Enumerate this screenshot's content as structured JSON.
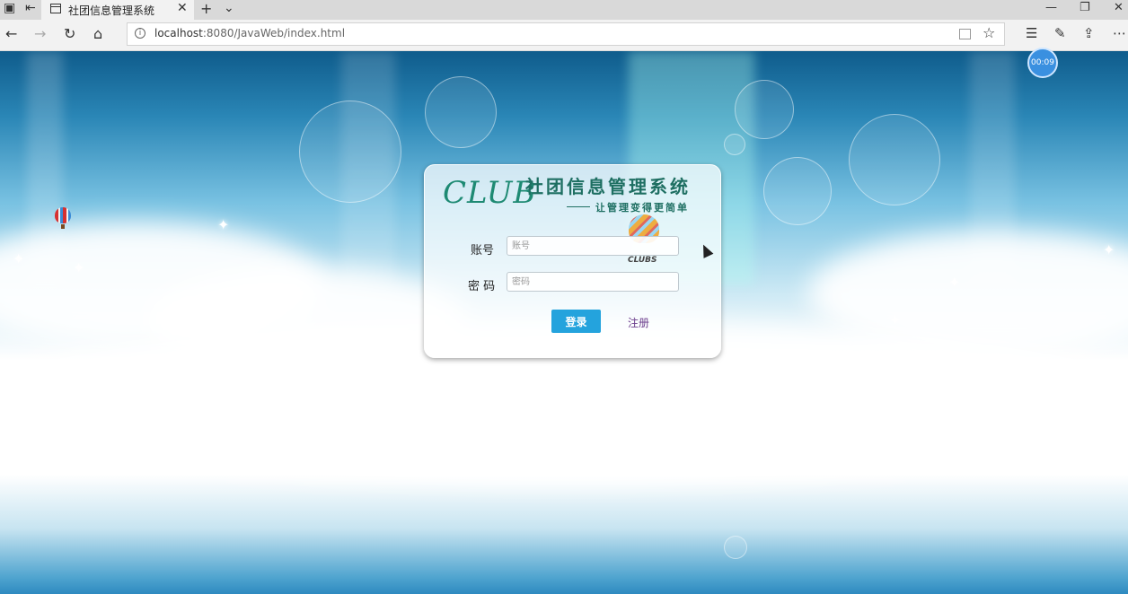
{
  "browser": {
    "tab_title": "社团信息管理系统",
    "tab_close_glyph": "✕",
    "new_tab_glyph": "+",
    "tab_list_glyph": "⌄",
    "url_host": "localhost",
    "url_rest": ":8080/JavaWeb/index.html",
    "window_controls": [
      "—",
      "❐",
      "✕"
    ],
    "nav_icons": [
      "back-icon",
      "forward-icon",
      "refresh-icon",
      "home-icon"
    ],
    "toolbar_icons": [
      "favorites-icon",
      "notes-icon",
      "share-icon",
      "more-icon"
    ]
  },
  "overlay": {
    "timer": "00:09"
  },
  "login": {
    "logo_club": "CLUB",
    "logo_title": "社团信息管理系统",
    "logo_slogan": "让管理变得更简单",
    "balloon_text": "CLUBS",
    "account_label": "账号",
    "account_placeholder": "账号",
    "password_label": "密 码",
    "password_placeholder": "密码",
    "login_button": "登录",
    "register_link": "注册"
  },
  "colors": {
    "accent_button": "#24a3dd",
    "link": "#6a3c8c",
    "logo": "#1e8a73",
    "timer": "#3a90e0"
  }
}
